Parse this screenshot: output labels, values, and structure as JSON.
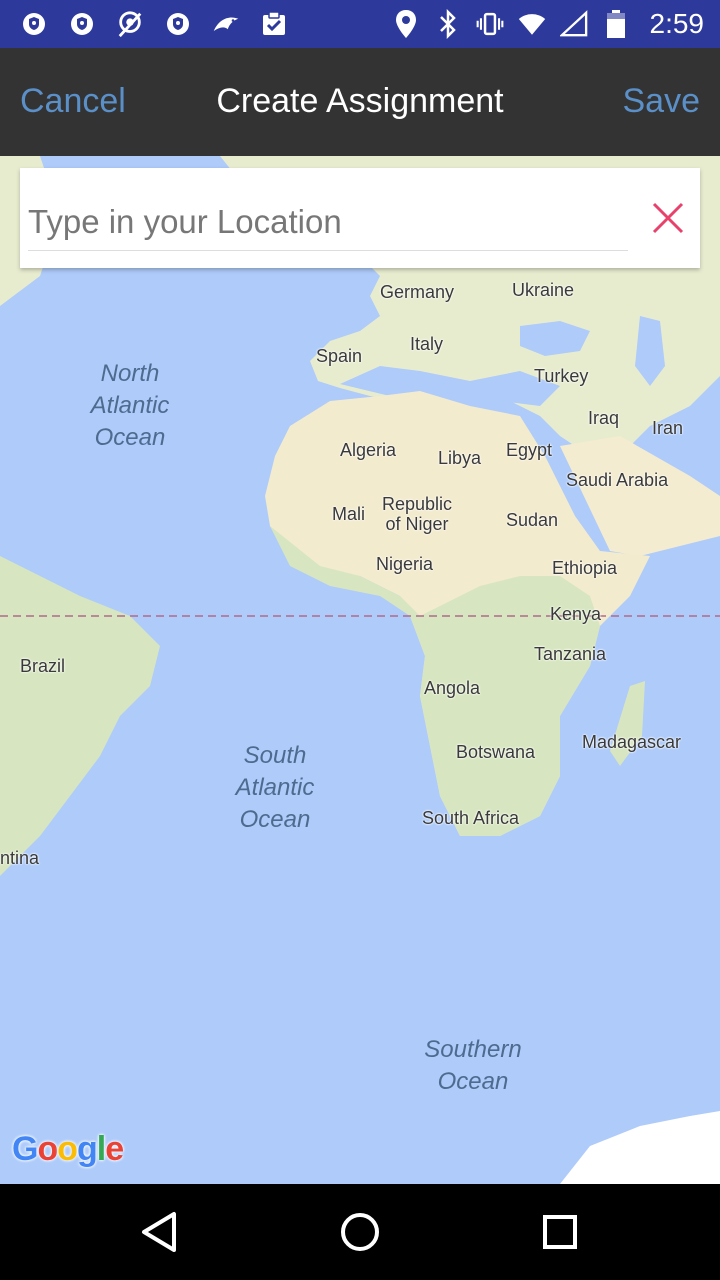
{
  "status_bar": {
    "time": "2:59",
    "left_icons": [
      "shield-icon",
      "shield-icon",
      "vpn-icon",
      "shield-icon",
      "dolphin-icon",
      "clipboard-check-icon"
    ],
    "right_icons": [
      "location-icon",
      "bluetooth-icon",
      "vibrate-icon",
      "wifi-icon",
      "signal-icon",
      "battery-icon"
    ]
  },
  "app_bar": {
    "cancel_label": "Cancel",
    "title": "Create Assignment",
    "save_label": "Save",
    "accent_color": "#5a8fc8"
  },
  "search": {
    "placeholder": "Type in your Location",
    "value": ""
  },
  "map": {
    "country_labels": [
      {
        "name": "Germany"
      },
      {
        "name": "Ukraine"
      },
      {
        "name": "Spain"
      },
      {
        "name": "Italy"
      },
      {
        "name": "Turkey"
      },
      {
        "name": "Iraq"
      },
      {
        "name": "Iran"
      },
      {
        "name": "Algeria"
      },
      {
        "name": "Libya"
      },
      {
        "name": "Egypt"
      },
      {
        "name": "Saudi Arabia"
      },
      {
        "name": "Mali"
      },
      {
        "name": "Republic of Niger"
      },
      {
        "name": "Sudan"
      },
      {
        "name": "Nigeria"
      },
      {
        "name": "Ethiopia"
      },
      {
        "name": "Kenya"
      },
      {
        "name": "Brazil"
      },
      {
        "name": "Tanzania"
      },
      {
        "name": "Angola"
      },
      {
        "name": "Madagascar"
      },
      {
        "name": "Botswana"
      },
      {
        "name": "South Africa"
      },
      {
        "name": "ntina"
      }
    ],
    "ocean_labels": [
      {
        "line1": "North",
        "line2": "Atlantic",
        "line3": "Ocean"
      },
      {
        "line1": "South",
        "line2": "Atlantic",
        "line3": "Ocean"
      },
      {
        "line1": "Southern",
        "line2": "Ocean"
      }
    ],
    "logo_text": "Google"
  },
  "nav_bar": {
    "icons": [
      "back-icon",
      "home-icon",
      "recents-icon"
    ]
  }
}
